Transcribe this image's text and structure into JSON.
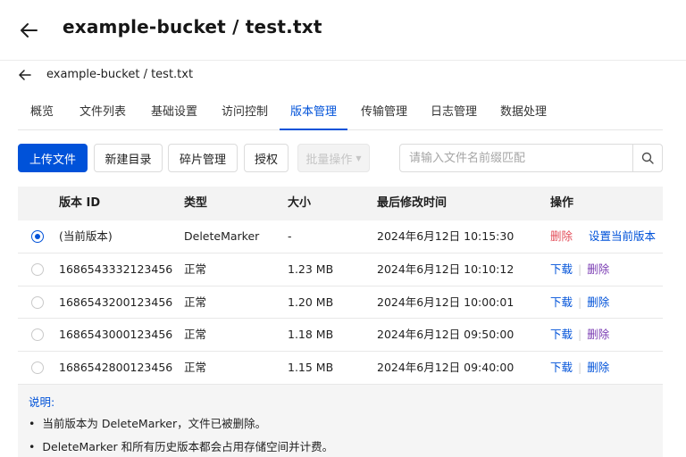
{
  "header": {
    "title": "example-bucket / test.txt",
    "subtitle": "example-bucket / test.txt"
  },
  "tabs": [
    {
      "label": "概览"
    },
    {
      "label": "文件列表"
    },
    {
      "label": "基础设置"
    },
    {
      "label": "访问控制"
    },
    {
      "label": "版本管理",
      "active": true
    },
    {
      "label": "传输管理"
    },
    {
      "label": "日志管理"
    },
    {
      "label": "数据处理"
    }
  ],
  "toolbar": {
    "upload": "上传文件",
    "new_dir": "新建目录",
    "fragments": "碎片管理",
    "authorize": "授权",
    "batch": "批量操作",
    "search_placeholder": "请输入文件名前缀匹配"
  },
  "table": {
    "headers": {
      "version_id": "版本 ID",
      "type": "类型",
      "size": "大小",
      "modified": "最后修改时间",
      "actions": "操作"
    },
    "rows": [
      {
        "version_id": "(当前版本)",
        "type": "DeleteMarker",
        "size": "-",
        "modified": "2024年6月12日 10:15:30",
        "action1": "删除",
        "action2": "设置当前版本",
        "selected": true
      },
      {
        "version_id": "1686543332123456",
        "type": "正常",
        "size": "1.23 MB",
        "modified": "2024年6月12日 10:10:12",
        "action1": "下载",
        "action2": "删除",
        "selected": false
      },
      {
        "version_id": "1686543200123456",
        "type": "正常",
        "size": "1.20 MB",
        "modified": "2024年6月12日 10:00:01",
        "action1": "下载",
        "action2": "删除",
        "selected": false
      },
      {
        "version_id": "1686543000123456",
        "type": "正常",
        "size": "1.18 MB",
        "modified": "2024年6月12日 09:50:00",
        "action1": "下载",
        "action2": "删除",
        "selected": false
      },
      {
        "version_id": "1686542800123456",
        "type": "正常",
        "size": "1.15 MB",
        "modified": "2024年6月12日 09:40:00",
        "action1": "下载",
        "action2": "删除",
        "selected": false
      }
    ]
  },
  "notes": {
    "title": "说明:",
    "items": [
      "当前版本为 DeleteMarker，文件已被删除。",
      "DeleteMarker 和所有历史版本都会占用存储空间并计费。"
    ]
  },
  "colors": {
    "accent": "#0052d9",
    "danger": "#e34d59",
    "muted_link": "#7a3cb3"
  },
  "icons": {
    "back": "arrow-left-icon",
    "search": "search-icon",
    "batch_caret": "chevron-down-icon"
  }
}
